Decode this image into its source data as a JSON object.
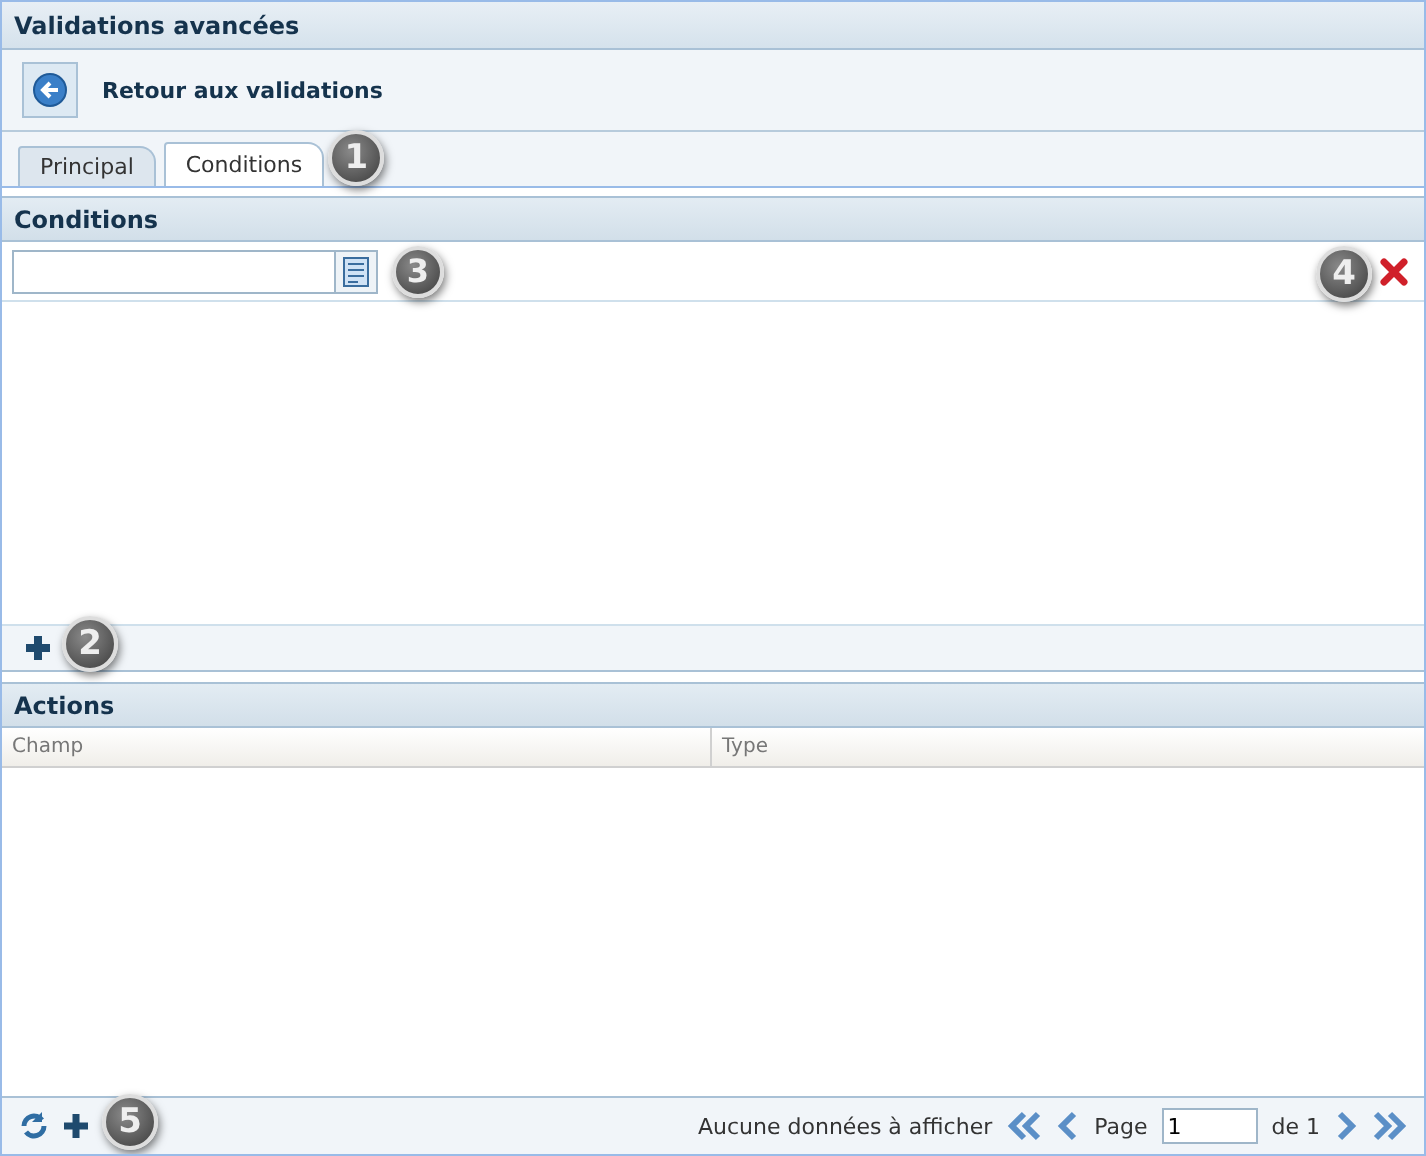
{
  "window": {
    "title": "Validations avancées"
  },
  "toolbar": {
    "back_button": {
      "label": "Retour aux validations"
    }
  },
  "tabs": [
    {
      "label": "Principal",
      "selected": false
    },
    {
      "label": "Conditions",
      "selected": true,
      "callout": "1"
    }
  ],
  "conditions": {
    "title": "Conditions",
    "field": {
      "callout": "3"
    },
    "delete_callout": "4",
    "add_callout": "2"
  },
  "actions": {
    "title": "Actions",
    "columns": [
      "Champ",
      "Type"
    ],
    "footer": {
      "add_callout": "5",
      "status": "Aucune données à afficher",
      "page_label": "Page",
      "page_value": "1",
      "page_total": "de 1"
    }
  }
}
